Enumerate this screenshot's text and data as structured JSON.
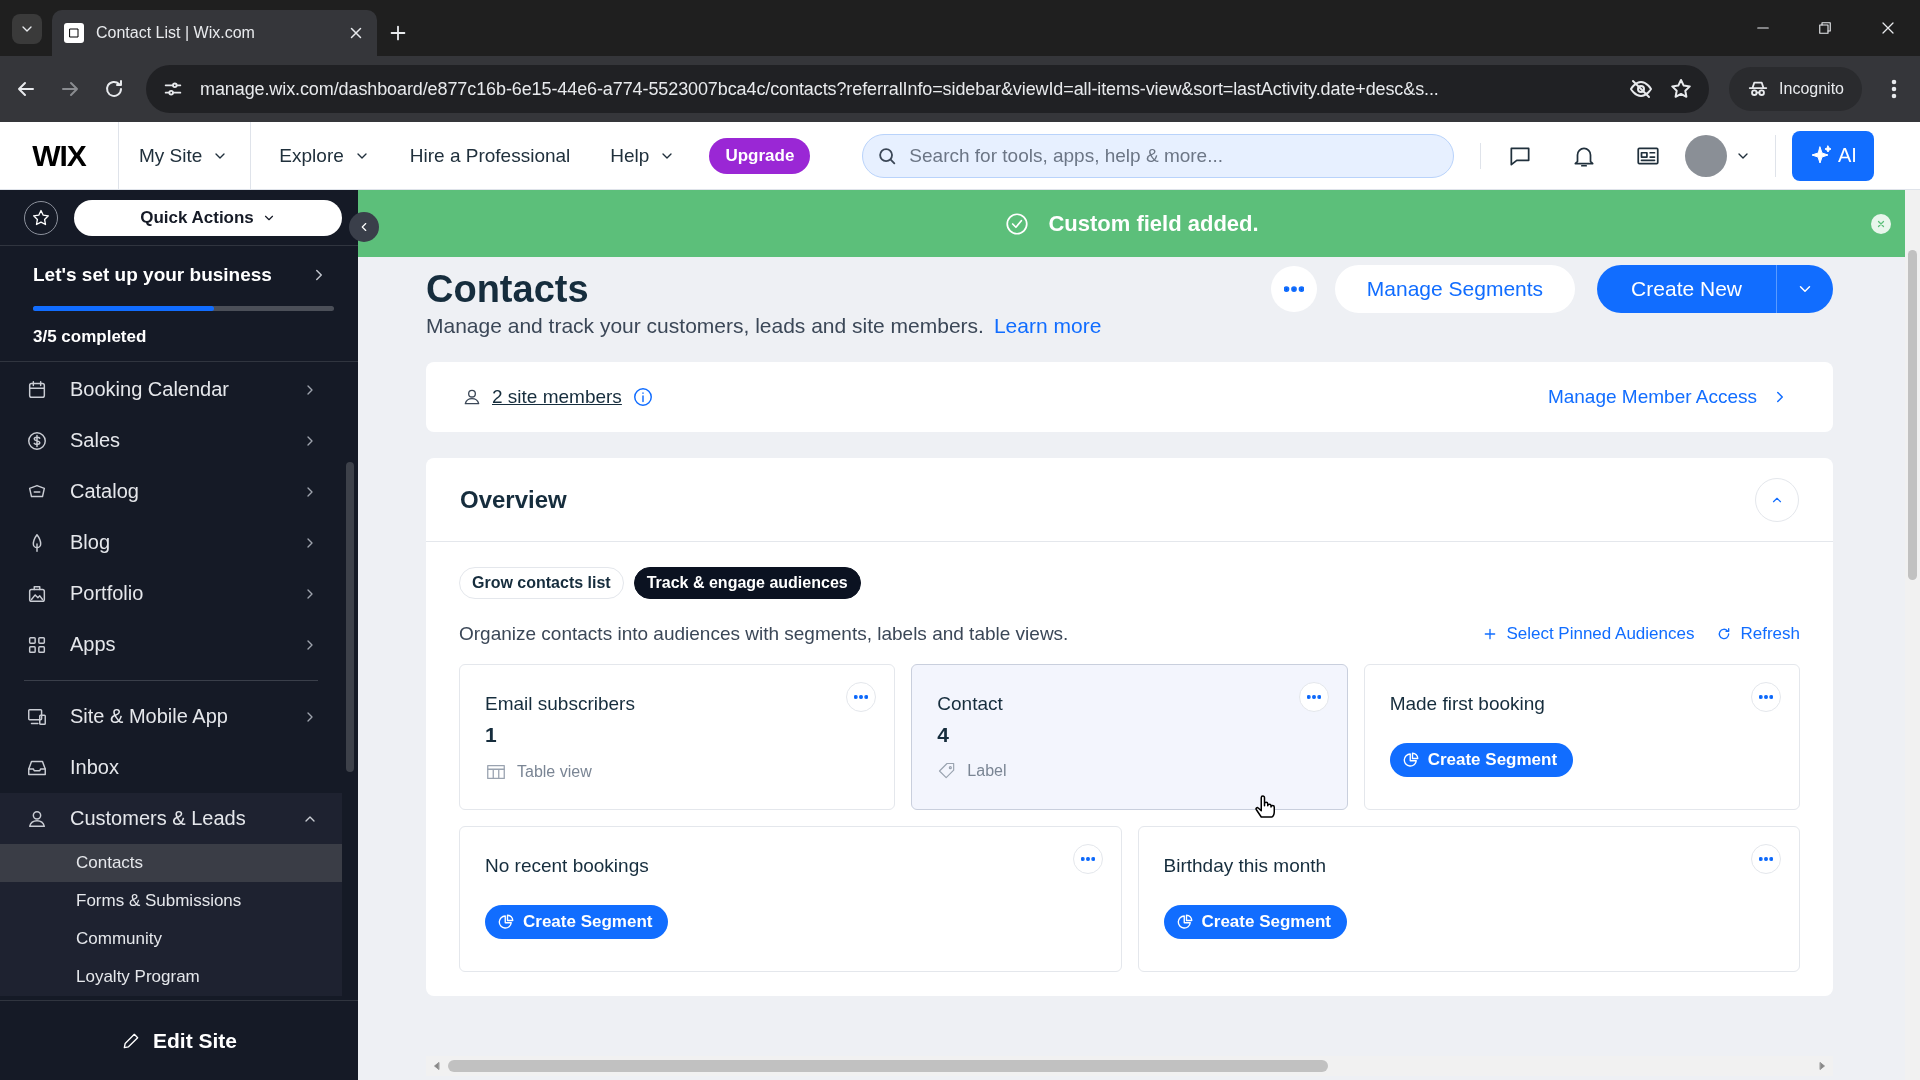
{
  "browser": {
    "tabs": [
      {
        "title": "Contact List | Wix.com",
        "selected": true
      }
    ],
    "url": "manage.wix.com/dashboard/e877c16b-6e15-44e6-a774-5523007bca4c/contacts?referralInfo=sidebar&viewId=all-items-view&sort=lastActivity.date+desc&s...",
    "incognito": "Incognito"
  },
  "header": {
    "logo": "WIX",
    "nav": [
      {
        "label": "My Site",
        "dropdown": true,
        "kind": "site_selector"
      },
      {
        "label": "Explore",
        "dropdown": true,
        "kind": "link"
      },
      {
        "label": "Hire a Professional",
        "dropdown": false,
        "kind": "link"
      },
      {
        "label": "Help",
        "dropdown": true,
        "kind": "link"
      }
    ],
    "upgrade": "Upgrade",
    "search": {
      "placeholder": "Search for tools, apps, help & more..."
    },
    "ai": "AI"
  },
  "sidebar": {
    "quick_actions": "Quick Actions",
    "setup": {
      "title": "Let's set up your business",
      "level": 0.6,
      "progress": "3/5 completed"
    },
    "sections": [
      [
        {
          "label": "Booking Calendar",
          "kind": "menu"
        },
        {
          "label": "Sales",
          "kind": "menu"
        },
        {
          "label": "Catalog",
          "kind": "menu"
        },
        {
          "label": "Blog",
          "kind": "menu"
        },
        {
          "label": "Portfolio",
          "kind": "menu"
        },
        {
          "label": "Apps",
          "kind": "menu"
        }
      ],
      [
        {
          "label": "Site & Mobile App",
          "kind": "menu"
        },
        {
          "label": "Inbox",
          "kind": "link"
        },
        {
          "label": "Customers & Leads",
          "kind": "group",
          "expanded": true,
          "children": [
            {
              "label": "Contacts",
              "selected": true
            },
            {
              "label": "Forms & Submissions",
              "selected": false
            },
            {
              "label": "Community",
              "selected": false
            },
            {
              "label": "Loyalty Program",
              "selected": false
            }
          ]
        }
      ]
    ],
    "edit_site": "Edit Site"
  },
  "toast": {
    "kind": "success",
    "message": "Custom field added."
  },
  "page": {
    "title": "Contacts",
    "subtitle": "Manage and track your customers, leads and site members.",
    "learn_more": "Learn more",
    "buttons": [
      {
        "label": "Manage Segments",
        "kind": "secondary"
      },
      {
        "label": "Create New",
        "kind": "primary"
      }
    ]
  },
  "members": {
    "link": "2 site members",
    "access": "Manage Member Access"
  },
  "overview": {
    "title": "Overview",
    "tabs": [
      {
        "label": "Grow contacts list",
        "selected": false
      },
      {
        "label": "Track & engage audiences",
        "selected": true
      }
    ],
    "description": "Organize contacts into audiences with segments, labels and table views.",
    "actions": [
      {
        "label": "Select Pinned Audiences",
        "kind": "add"
      },
      {
        "label": "Refresh",
        "kind": "refresh"
      }
    ],
    "rows": [
      [
        {
          "title": "Email subscribers",
          "count": "1",
          "meta": "Table view",
          "kind": "table",
          "highlighted": false
        },
        {
          "title": "Contact",
          "count": "4",
          "meta": "Label",
          "kind": "label",
          "highlighted": true
        },
        {
          "title": "Made first booking",
          "button": "Create Segment",
          "kind": "segment",
          "highlighted": false
        }
      ],
      [
        {
          "title": "No recent bookings",
          "button": "Create Segment",
          "kind": "segment",
          "highlighted": false
        },
        {
          "title": "Birthday this month",
          "button": "Create Segment",
          "kind": "segment",
          "highlighted": false
        }
      ]
    ]
  }
}
